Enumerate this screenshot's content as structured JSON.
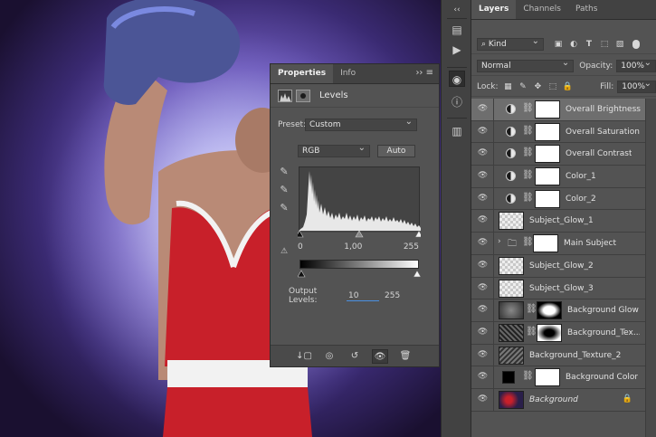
{
  "properties": {
    "tabs": [
      "Properties",
      "Info"
    ],
    "menu_icon": "panel-menu-icon",
    "title": "Levels",
    "preset_label": "Preset:",
    "preset_value": "Custom",
    "channel_value": "RGB",
    "auto_label": "Auto",
    "input_levels": [
      "0",
      "1,00",
      "255"
    ],
    "output_label": "Output Levels:",
    "output_values": [
      "10",
      "255"
    ]
  },
  "layers_panel": {
    "tabs": [
      "Layers",
      "Channels",
      "Paths"
    ],
    "filter_label": "Kind",
    "blend_mode": "Normal",
    "opacity_label": "Opacity:",
    "opacity_value": "100%",
    "lock_label": "Lock:",
    "fill_label": "Fill:",
    "fill_value": "100%",
    "layers": [
      {
        "name": "Overall Brightness",
        "type": "adjustment",
        "selected": true
      },
      {
        "name": "Overall Saturation",
        "type": "adjustment"
      },
      {
        "name": "Overall Contrast",
        "type": "adjustment"
      },
      {
        "name": "Color_1",
        "type": "adjustment"
      },
      {
        "name": "Color_2",
        "type": "adjustment"
      },
      {
        "name": "Subject_Glow_1",
        "type": "pixel"
      },
      {
        "name": "Main Subject",
        "type": "group"
      },
      {
        "name": "Subject_Glow_2",
        "type": "pixel"
      },
      {
        "name": "Subject_Glow_3",
        "type": "pixel"
      },
      {
        "name": "Background Glow",
        "type": "masked"
      },
      {
        "name": "Background_Tex...",
        "type": "masked"
      },
      {
        "name": "Background_Texture_2",
        "type": "texture"
      },
      {
        "name": "Background Color",
        "type": "fill"
      },
      {
        "name": "Background",
        "type": "background",
        "locked": true
      }
    ]
  },
  "colors": {
    "panel_bg": "#535353",
    "tab_bar": "#424242",
    "selected_row": "#6e6e6e",
    "photo_glow": "#a9a6e8",
    "shirt_red": "#c8202a"
  }
}
